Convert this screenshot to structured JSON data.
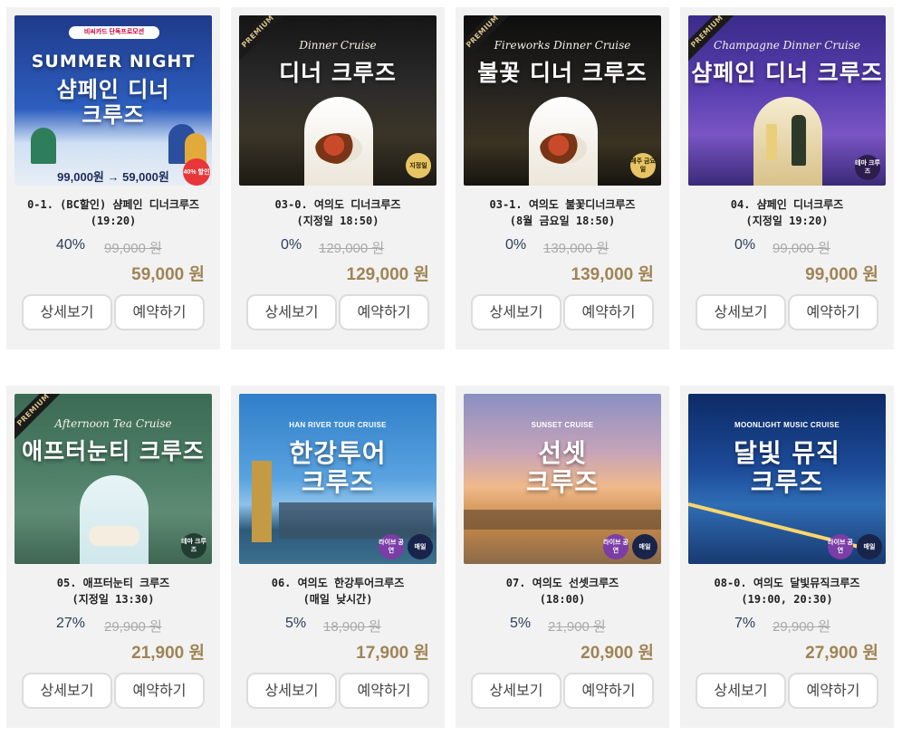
{
  "products": [
    {
      "title": "0-1. (BC할인) 샴페인 디너크루즈",
      "subtitle": "(19:20)",
      "discount": "40%",
      "original_price": "99,000 원",
      "price": "59,000 원",
      "image": {
        "top_badge": "비씨카드 단독프로모션",
        "heading_en": "SUMMER NIGHT",
        "heading_line1": "샴페인 디너",
        "heading_line2": "크루즈",
        "price_strip": "99,000원 → 59,000원",
        "corner_badge": "40% 할인"
      },
      "detail_label": "상세보기",
      "reserve_label": "예약하기"
    },
    {
      "title": "03-0. 여의도 디너크루즈",
      "subtitle": "(지정일 18:50)",
      "discount": "0%",
      "original_price": "129,000 원",
      "price": "129,000 원",
      "image": {
        "ribbon": "PREMIUM",
        "script": "Dinner Cruise",
        "heading": "디너 크루즈",
        "badge": "지정일"
      },
      "detail_label": "상세보기",
      "reserve_label": "예약하기"
    },
    {
      "title": "03-1. 여의도 불꽃디너크루즈",
      "subtitle": "(8월 금요일 18:50)",
      "discount": "0%",
      "original_price": "139,000 원",
      "price": "139,000 원",
      "image": {
        "ribbon": "PREMIUM",
        "script": "Fireworks Dinner Cruise",
        "heading": "불꽃 디너 크루즈",
        "badge": "매주 금요일"
      },
      "detail_label": "상세보기",
      "reserve_label": "예약하기"
    },
    {
      "title": "04. 샴페인 디너크루즈",
      "subtitle": "(지정일 19:20)",
      "discount": "0%",
      "original_price": "99,000 원",
      "price": "99,000 원",
      "image": {
        "ribbon": "PREMIUM",
        "script": "Champagne Dinner Cruise",
        "heading": "샴페인 디너 크루즈",
        "badge": "테마 크루즈"
      },
      "detail_label": "상세보기",
      "reserve_label": "예약하기"
    },
    {
      "title": "05. 애프터눈티 크루즈",
      "subtitle": "(지정일 13:30)",
      "discount": "27%",
      "original_price": "29,900 원",
      "price": "21,900 원",
      "image": {
        "ribbon": "PREMIUM",
        "script": "Afternoon Tea Cruise",
        "heading": "애프터눈티 크루즈",
        "badge": "테마 크루즈"
      },
      "detail_label": "상세보기",
      "reserve_label": "예약하기"
    },
    {
      "title": "06. 여의도 한강투어크루즈",
      "subtitle": "(매일 낮시간)",
      "discount": "5%",
      "original_price": "18,900 원",
      "price": "17,900 원",
      "image": {
        "small_heading": "HAN RIVER TOUR CRUISE",
        "heading_line1": "한강투어",
        "heading_line2": "크루즈",
        "badge_a": "라이브 공연",
        "badge_b": "매일"
      },
      "detail_label": "상세보기",
      "reserve_label": "예약하기"
    },
    {
      "title": "07. 여의도 선셋크루즈",
      "subtitle": "(18:00)",
      "discount": "5%",
      "original_price": "21,900 원",
      "price": "20,900 원",
      "image": {
        "small_heading": "SUNSET CRUISE",
        "heading_line1": "선셋",
        "heading_line2": "크루즈",
        "badge_a": "라이브 공연",
        "badge_b": "매일"
      },
      "detail_label": "상세보기",
      "reserve_label": "예약하기"
    },
    {
      "title": "08-0. 여의도 달빛뮤직크루즈",
      "subtitle": "(19:00, 20:30)",
      "discount": "7%",
      "original_price": "29,900 원",
      "price": "27,900 원",
      "image": {
        "small_heading": "MOONLIGHT MUSIC CRUISE",
        "heading_line1": "달빛 뮤직",
        "heading_line2": "크루즈",
        "badge_a": "라이브 공연",
        "badge_b": "매일"
      },
      "detail_label": "상세보기",
      "reserve_label": "예약하기"
    }
  ]
}
